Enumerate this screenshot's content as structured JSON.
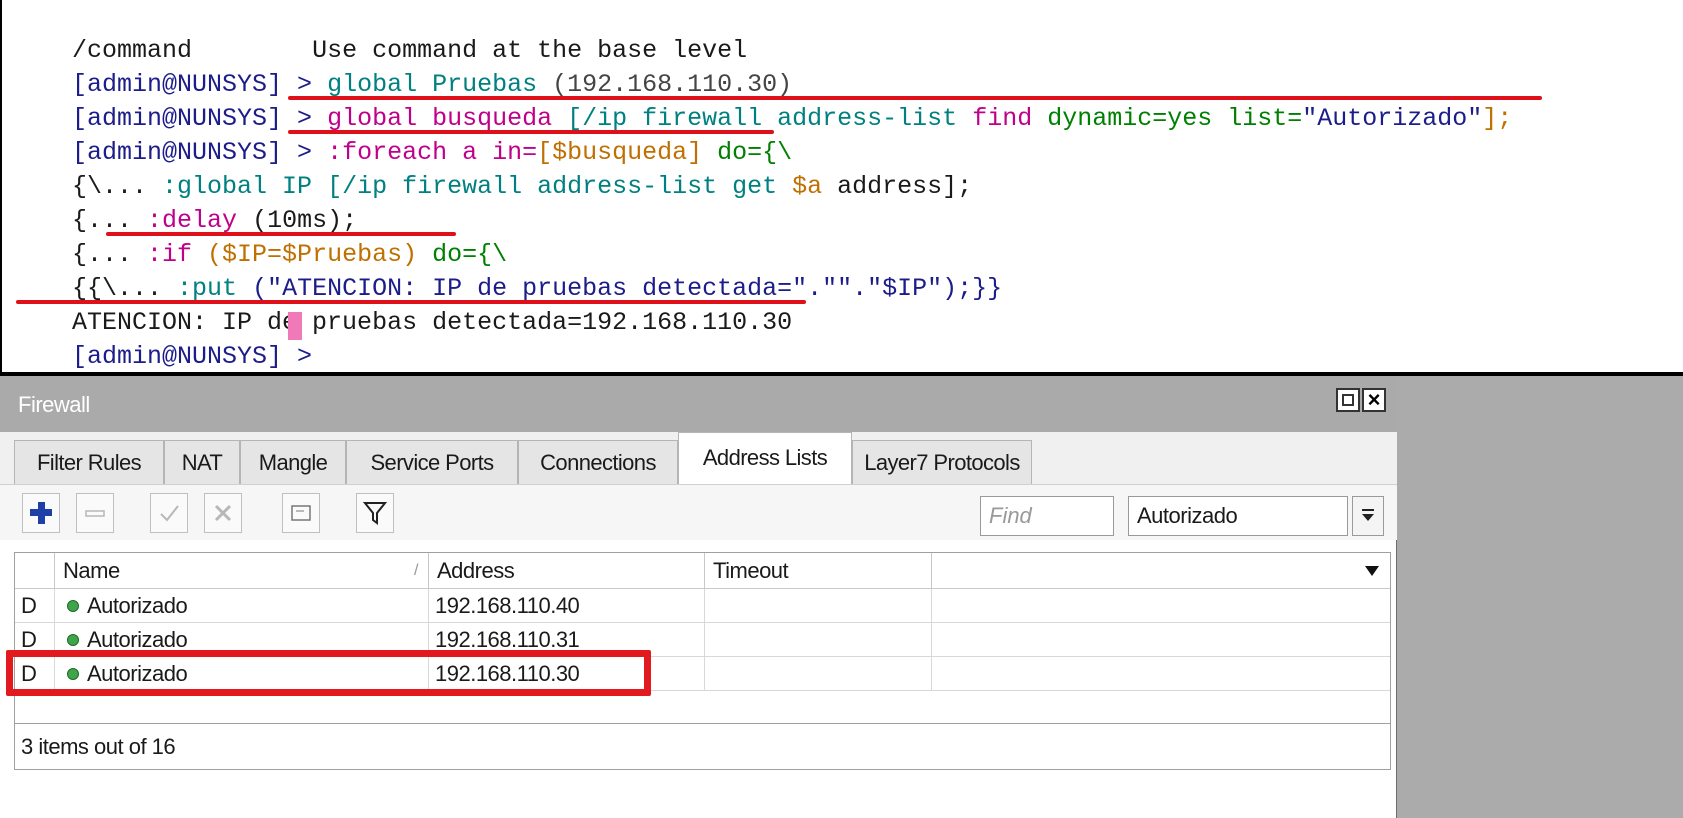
{
  "terminal": {
    "line0": {
      "a": "/command",
      "b": "Use command at the base level"
    },
    "line1": {
      "prompt": "[admin@NUNSYS] > ",
      "cmd": "global Pruebas ",
      "arg": "(192.168.110.30)"
    },
    "line2": {
      "prompt": "[admin@NUNSYS] > ",
      "cmd": "global busqueda ",
      "b1": "[/ip firewall address-list ",
      "find": "find ",
      "dyn": "dynamic=yes ",
      "list": "list=",
      "str": "\"Autorizado\"",
      "end": "];"
    },
    "line3": {
      "prompt": "[admin@NUNSYS] > ",
      "kw": ":foreach a in=",
      "arr": "[$busqueda]",
      "do": " do={\\"
    },
    "line4": {
      "pre": "{\\... ",
      "kw": ":global IP ",
      "b": "[/ip firewall address-list get ",
      "var": "$a",
      "rest": " address];"
    },
    "line5": {
      "pre": "{... ",
      "kw": ":delay ",
      "arg": "(10ms);"
    },
    "line6": {
      "pre": "{... ",
      "kw": ":if ",
      "cond": "($IP=$Pruebas)",
      "do": " do={\\"
    },
    "line7": {
      "pre": "{{\\... ",
      "kw": ":put ",
      "arg": "(\"ATENCION: IP de pruebas detectada=\".\"\".\"$IP\");}}"
    },
    "line8": "ATENCION: IP de pruebas detectada=192.168.110.30",
    "line9": {
      "prompt": "[admin@NUNSYS] > "
    }
  },
  "window": {
    "title": "Firewall",
    "tabs": [
      "Filter Rules",
      "NAT",
      "Mangle",
      "Service Ports",
      "Connections",
      "Address Lists",
      "Layer7 Protocols"
    ],
    "active_tab": "Address Lists"
  },
  "toolbar": {
    "add_icon": "plus-icon",
    "remove_icon": "minus-icon",
    "enable_icon": "check-icon",
    "disable_icon": "cross-icon",
    "comment_icon": "comment-icon",
    "filter_icon": "filter-icon",
    "find_placeholder": "Find",
    "list_filter": "Autorizado"
  },
  "table": {
    "columns": [
      "Name",
      "Address",
      "Timeout"
    ],
    "sort_indicator": "/",
    "rows": [
      {
        "flag": "D",
        "name": "Autorizado",
        "address": "192.168.110.40",
        "timeout": ""
      },
      {
        "flag": "D",
        "name": "Autorizado",
        "address": "192.168.110.31",
        "timeout": ""
      },
      {
        "flag": "D",
        "name": "Autorizado",
        "address": "192.168.110.30",
        "timeout": ""
      }
    ]
  },
  "status": "3 items out of 16",
  "colors": {
    "underline": "#e0101a",
    "highlight": "#e21a20",
    "cursor": "#f07ab8",
    "status_dot": "#3fa54a"
  }
}
